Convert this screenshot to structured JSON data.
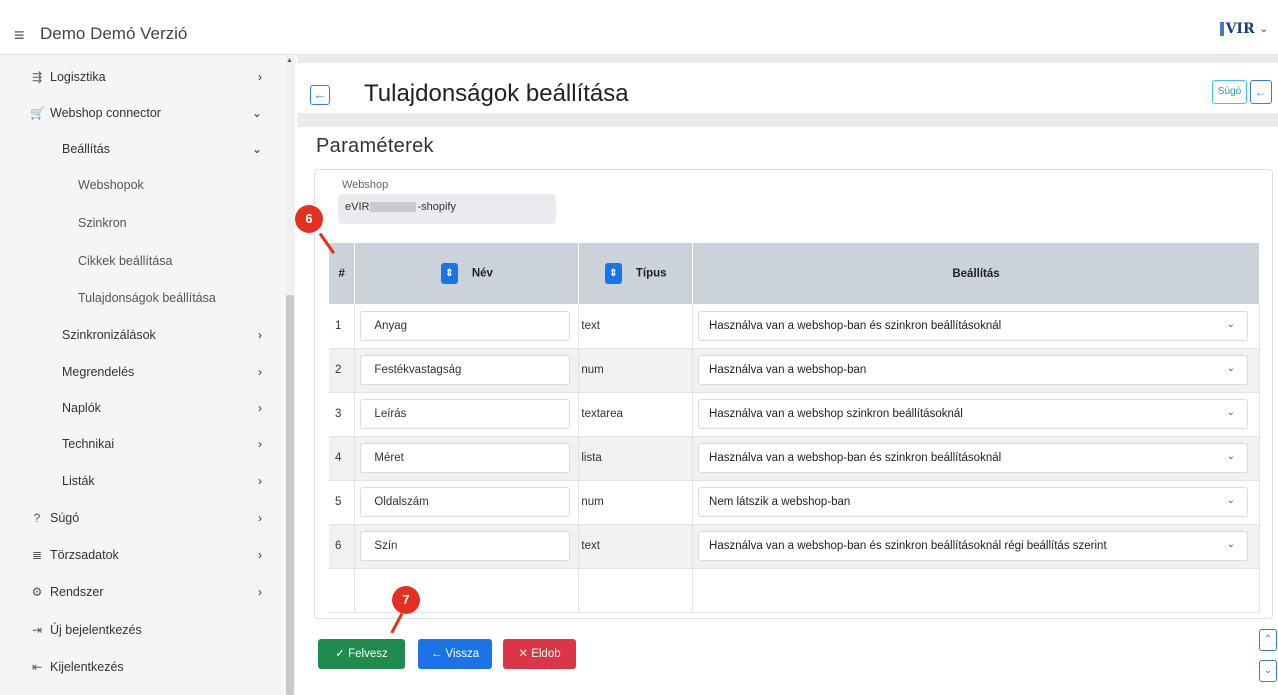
{
  "header": {
    "menu_icon": "hamburger-icon",
    "title": "Demo Demó Verzió",
    "logo_text": "VIR"
  },
  "sidebar": {
    "items": [
      {
        "label": "Logisztika",
        "icon": "truck-icon",
        "glyph": "⇶",
        "chevron": "›",
        "level": 1
      },
      {
        "label": "Webshop connector",
        "icon": "cart-icon",
        "glyph": "🛒",
        "chevron": "⌄",
        "level": 1
      },
      {
        "label": "Beállítás",
        "chevron": "⌄",
        "level": 2
      },
      {
        "label": "Webshopok",
        "level": 3
      },
      {
        "label": "Szinkron",
        "level": 3
      },
      {
        "label": "Cikkek beállítása",
        "level": 3
      },
      {
        "label": "Tulajdonságok beállítása",
        "level": 3
      },
      {
        "label": "Szinkronizálások",
        "chevron": "›",
        "level": 2
      },
      {
        "label": "Megrendelés",
        "chevron": "›",
        "level": 2
      },
      {
        "label": "Naplók",
        "chevron": "›",
        "level": 2
      },
      {
        "label": "Technikai",
        "chevron": "›",
        "level": 2
      },
      {
        "label": "Listák",
        "chevron": "›",
        "level": 2
      },
      {
        "label": "Súgó",
        "icon": "question-circle-icon",
        "glyph": "?",
        "chevron": "›",
        "level": 1
      },
      {
        "label": "Törzsadatok",
        "icon": "database-icon",
        "glyph": "≣",
        "chevron": "›",
        "level": 1
      },
      {
        "label": "Rendszer",
        "icon": "gears-icon",
        "glyph": "⚙",
        "chevron": "›",
        "level": 1
      },
      {
        "label": "Új bejelentkezés",
        "icon": "sign-in-icon",
        "glyph": "⇥",
        "level": 1
      },
      {
        "label": "Kijelentkezés",
        "icon": "sign-out-icon",
        "glyph": "⇤",
        "level": 1
      }
    ]
  },
  "page": {
    "title": "Tulajdonságok beállítása",
    "help_label": "Súgó",
    "section_title": "Paraméterek",
    "webshop_label": "Webshop",
    "webshop_value_prefix": "eVIR",
    "webshop_value_suffix": "-shopify"
  },
  "table": {
    "headers": {
      "index": "#",
      "name": "Név",
      "type": "Típus",
      "setting": "Beállítás"
    },
    "rows": [
      {
        "index": "1",
        "name": "Anyag",
        "type": "text",
        "setting": "Használva van a webshop-ban és szinkron beállításoknál"
      },
      {
        "index": "2",
        "name": "Festékvastagság",
        "type": "num",
        "setting": "Használva van a webshop-ban"
      },
      {
        "index": "3",
        "name": "Leírás",
        "type": "textarea",
        "setting": "Használva van a webshop szinkron beállításoknál"
      },
      {
        "index": "4",
        "name": "Méret",
        "type": "lista",
        "setting": "Használva van a webshop-ban és szinkron beállításoknál"
      },
      {
        "index": "5",
        "name": "Oldalszám",
        "type": "num",
        "setting": "Nem látszik a webshop-ban"
      },
      {
        "index": "6",
        "name": "Szín",
        "type": "text",
        "setting": "Használva van a webshop-ban és szinkron beállításoknál régi beállítás szerint"
      }
    ]
  },
  "buttons": {
    "save": "✓  Felvesz",
    "back": "← Vissza",
    "drop": "✕  Eldob"
  },
  "annotations": {
    "badge_6": "6",
    "badge_7": "7"
  },
  "colors": {
    "primary": "#1a74e8",
    "success": "#1f8b4c",
    "danger": "#dc3545",
    "badge": "#e4301f",
    "header_cell": "#ccd2d9"
  }
}
